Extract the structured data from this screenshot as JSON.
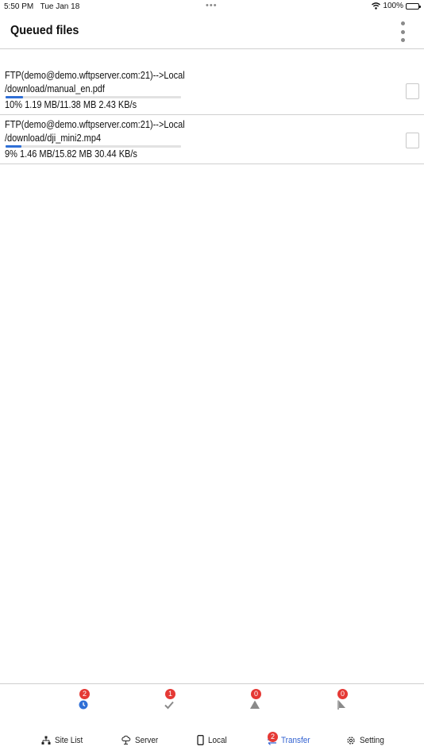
{
  "status_bar": {
    "time": "5:50 PM",
    "date": "Tue Jan 18",
    "dots": "•••",
    "battery_text": "100%",
    "wifi_icon": "wifi-icon",
    "battery_icon": "battery-icon"
  },
  "header": {
    "title": "Queued files",
    "menu_icon": "more-vertical-icon"
  },
  "queue": [
    {
      "route": "FTP(demo@demo.wftpserver.com:21)-->Local",
      "path": "/download/manual_en.pdf",
      "progress": 0.1,
      "stats": "10%  1.19 MB/11.38 MB  2.43 KB/s",
      "checked": false
    },
    {
      "route": "FTP(demo@demo.wftpserver.com:21)-->Local",
      "path": "/download/dji_mini2.mp4",
      "progress": 0.09,
      "stats": "9%  1.46 MB/15.82 MB  30.44 KB/s",
      "checked": false
    }
  ],
  "status_filters": [
    {
      "icon": "clock-icon",
      "count": "2",
      "color": "#2f6fd6"
    },
    {
      "icon": "checkmark-icon",
      "count": "1",
      "color": "#8a8a8a"
    },
    {
      "icon": "warning-icon",
      "count": "0",
      "color": "#8a8a8a"
    },
    {
      "icon": "stop-flag-icon",
      "count": "0",
      "color": "#8a8a8a"
    }
  ],
  "tabs": [
    {
      "label": "Site List",
      "icon": "sitemap-icon"
    },
    {
      "label": "Server",
      "icon": "cloud-icon"
    },
    {
      "label": "Local",
      "icon": "phone-icon"
    },
    {
      "label": "Transfer",
      "icon": "transfer-arrows-icon",
      "badge": "2",
      "active": true
    },
    {
      "label": "Setting",
      "icon": "gear-icon"
    }
  ],
  "colors": {
    "accent": "#2f5fd0",
    "progress": "#2f6fd6",
    "badge": "#e53935"
  }
}
